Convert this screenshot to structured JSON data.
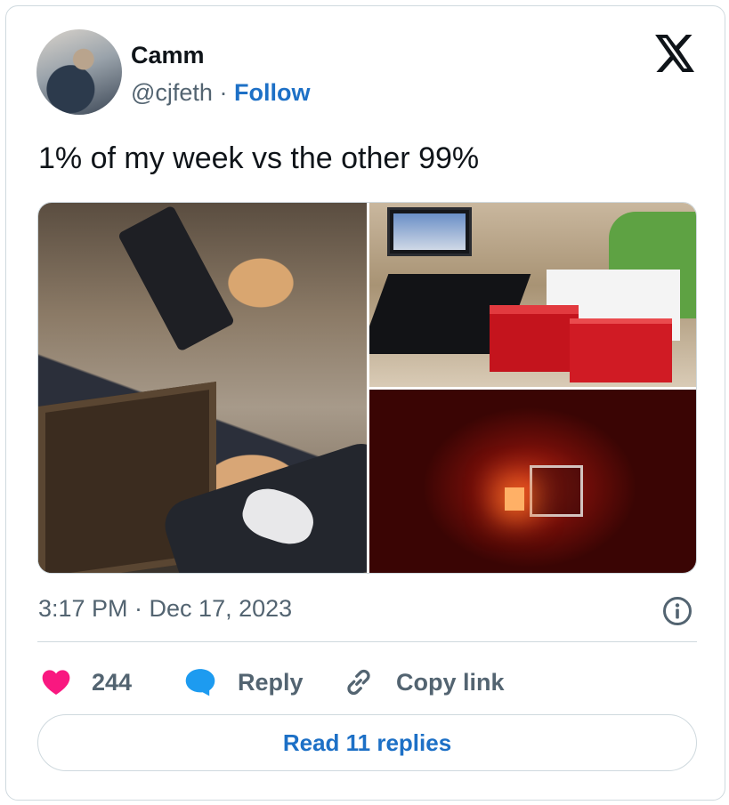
{
  "author": {
    "name": "Camm",
    "handle": "@cjfeth",
    "separator": "·",
    "follow_label": "Follow"
  },
  "tweet": {
    "text": "1% of my week vs the other 99%",
    "timestamp": "3:17 PM · Dec 17, 2023"
  },
  "media": {
    "photo_count": 3
  },
  "actions": {
    "like_count": "244",
    "reply_label": "Reply",
    "copy_link_label": "Copy link"
  },
  "footer": {
    "read_replies_label": "Read 11 replies"
  },
  "colors": {
    "link_blue": "#1d70c6",
    "like_pink": "#f91880",
    "reply_blue": "#1d9bf0",
    "muted_text": "#536471",
    "border": "#cfd9de"
  },
  "icons": {
    "brand": "x-logo-icon",
    "info": "info-icon",
    "like": "heart-icon",
    "reply": "speech-bubble-icon",
    "copy": "link-icon"
  }
}
